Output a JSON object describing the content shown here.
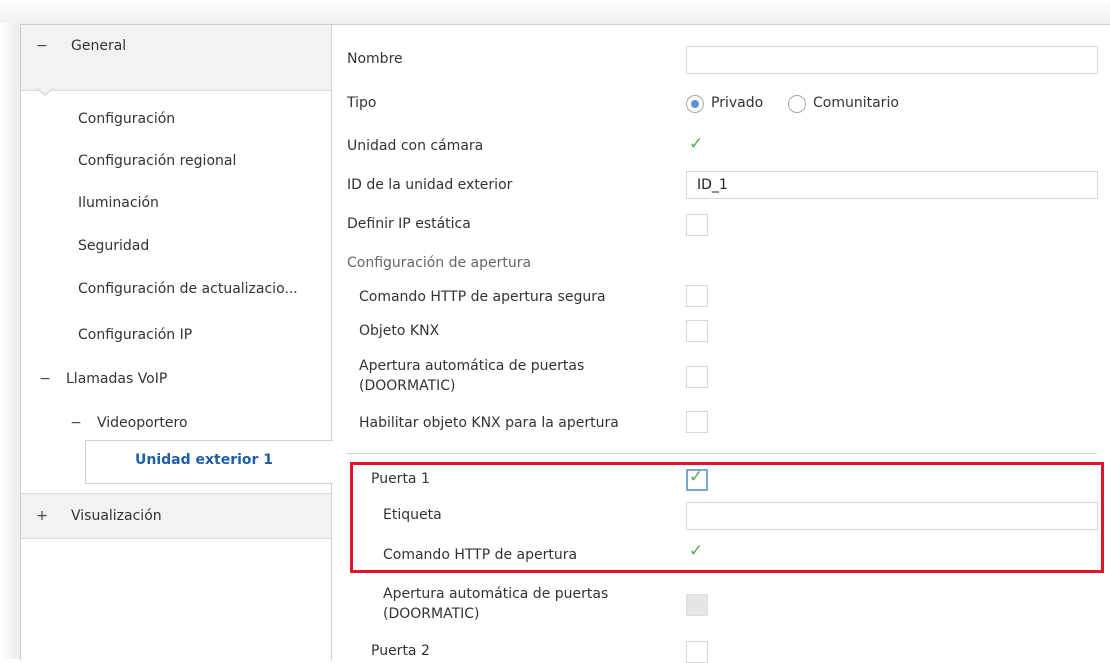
{
  "tree": {
    "general": {
      "sign": "−",
      "label": "General"
    },
    "items": [
      {
        "label": "Configuración"
      },
      {
        "label": "Configuración regional"
      },
      {
        "label": "Iluminación"
      },
      {
        "label": "Seguridad"
      },
      {
        "label": "Configuración de actualizacio..."
      },
      {
        "label": "Configuración IP"
      }
    ],
    "voip": {
      "sign": "−",
      "label": "Llamadas VoIP"
    },
    "videoportero": {
      "sign": "−",
      "label": "Videoportero"
    },
    "selected": {
      "label": "Unidad exterior 1"
    },
    "visualizacion": {
      "sign": "+",
      "label": "Visualización"
    }
  },
  "form": {
    "nombre": {
      "label": "Nombre",
      "value": ""
    },
    "tipo": {
      "label": "Tipo",
      "options": [
        "Privado",
        "Comunitario"
      ],
      "selected": "Privado"
    },
    "camara": {
      "label": "Unidad con cámara",
      "checked": true
    },
    "id_unidad": {
      "label": "ID de la unidad exterior",
      "value": "ID_1"
    },
    "ip_estatica": {
      "label": "Definir IP estática",
      "checked": false
    },
    "config_apertura": {
      "label": "Configuración de apertura"
    },
    "http_segura": {
      "label": "Comando HTTP de apertura segura",
      "checked": false
    },
    "objeto_knx": {
      "label": "Objeto KNX",
      "checked": false
    },
    "doormatic": {
      "label_line1": "Apertura automática de puertas",
      "label_line2": "(DOORMATIC)",
      "checked": false
    },
    "habilitar_knx": {
      "label": "Habilitar objeto KNX para la apertura",
      "checked": false
    },
    "puerta1": {
      "label": "Puerta 1",
      "checked": true
    },
    "etiqueta": {
      "label": "Etiqueta",
      "value": ""
    },
    "http_apertura": {
      "label": "Comando HTTP de apertura",
      "checked": true
    },
    "doormatic2": {
      "label_line1": "Apertura automática de puertas",
      "label_line2": "(DOORMATIC)",
      "checked": false,
      "disabled": true
    },
    "puerta2": {
      "label": "Puerta 2",
      "checked": false
    }
  },
  "colors": {
    "highlight": "#e0142a",
    "check": "#4caf50",
    "selected_text": "#1f5fa8"
  }
}
